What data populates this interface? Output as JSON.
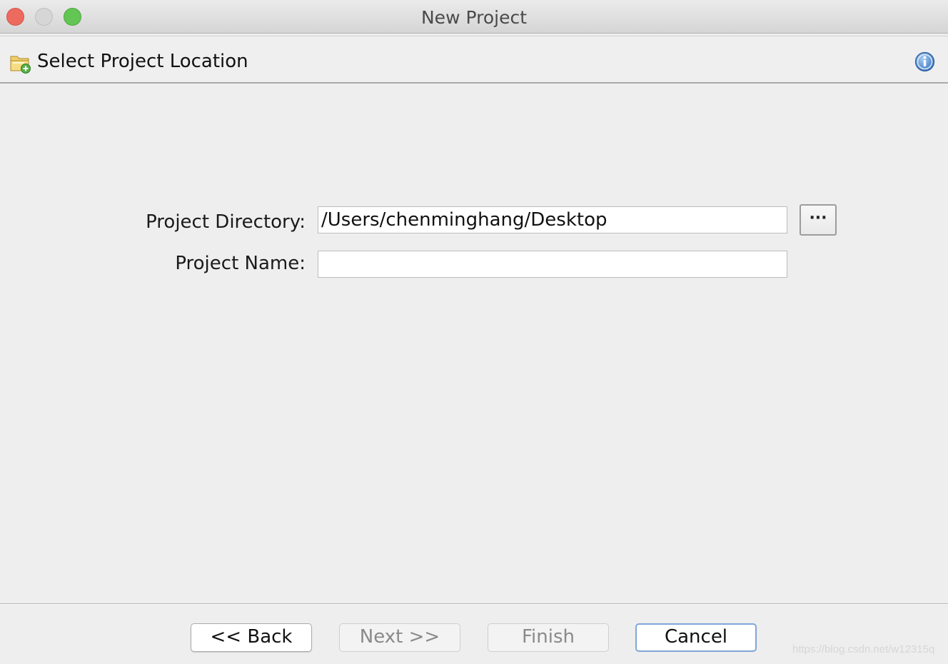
{
  "window": {
    "title": "New Project",
    "buttons": [
      "close",
      "minimize",
      "maximize"
    ]
  },
  "header": {
    "title": "Select Project Location",
    "icon": "folder-add-icon",
    "info_icon": "info-icon"
  },
  "form": {
    "directory_label": "Project Directory:",
    "directory_value": "/Users/chenminghang/Desktop",
    "browse_label": "···",
    "name_label": "Project Name:",
    "name_value": ""
  },
  "footer": {
    "back_label": "<< Back",
    "next_label": "Next >>",
    "finish_label": "Finish",
    "cancel_label": "Cancel"
  },
  "watermark": "https://blog.csdn.net/w12315q",
  "colors": {
    "close": "#ed6a5e",
    "minimize": "#d6d6d6",
    "maximize": "#62c554",
    "default_button_border": "#7fa7d9"
  }
}
